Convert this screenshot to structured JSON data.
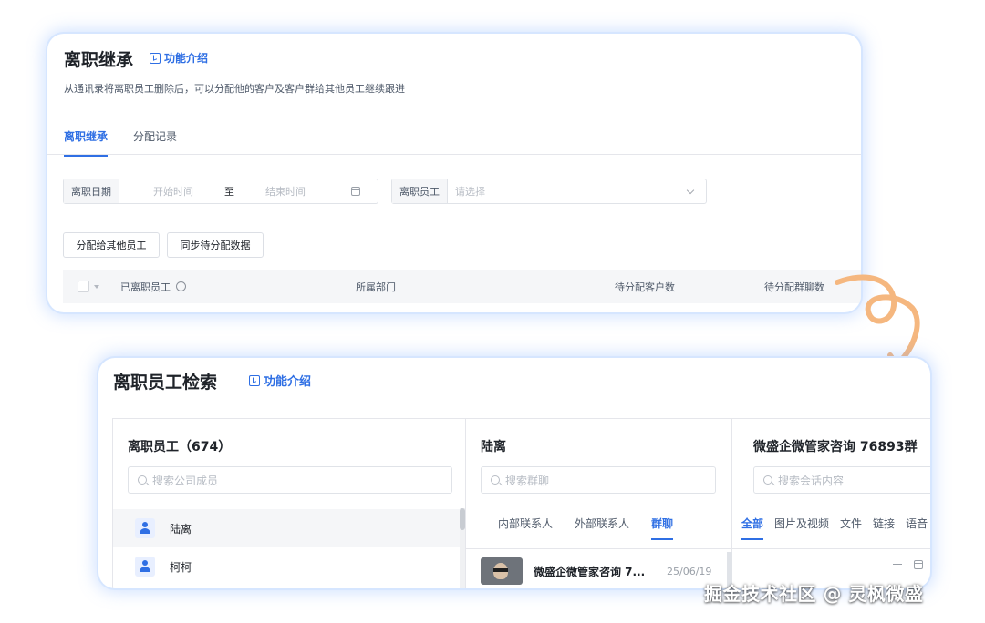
{
  "card1": {
    "title": "离职继承",
    "intro_link": "功能介绍",
    "description": "从通讯录将离职员工删除后，可以分配他的客户及客户群给其他员工继续跟进",
    "tabs": [
      {
        "label": "离职继承",
        "active": true
      },
      {
        "label": "分配记录",
        "active": false
      }
    ],
    "filters": {
      "date_label": "离职日期",
      "start_placeholder": "开始时间",
      "to": "至",
      "end_placeholder": "结束时间",
      "employee_label": "离职员工",
      "employee_placeholder": "请选择"
    },
    "buttons": {
      "assign": "分配给其他员工",
      "sync": "同步待分配数据"
    },
    "table_headers": [
      "已离职员工",
      "所属部门",
      "待分配客户数",
      "待分配群聊数"
    ]
  },
  "card2": {
    "title": "离职员工检索",
    "intro_link": "功能介绍",
    "employees_panel": {
      "heading": "离职员工（674）",
      "search_placeholder": "搜索公司成员",
      "employees": [
        {
          "name": "陆离",
          "selected": true
        },
        {
          "name": "柯柯",
          "selected": false
        }
      ]
    },
    "groups_panel": {
      "heading": "陆离",
      "search_placeholder": "搜索群聊",
      "tabs": [
        {
          "label": "内部联系人",
          "active": false
        },
        {
          "label": "外部联系人",
          "active": false
        },
        {
          "label": "群聊",
          "active": true
        }
      ],
      "groups": [
        {
          "name": "微盛企微管家咨询 7...",
          "date": "25/06/19"
        }
      ]
    },
    "chat_panel": {
      "heading": "微盛企微管家咨询 76893群",
      "search_placeholder": "搜索会话内容",
      "tabs": [
        {
          "label": "全部",
          "active": true
        },
        {
          "label": "图片及视频",
          "active": false
        },
        {
          "label": "文件",
          "active": false
        },
        {
          "label": "链接",
          "active": false
        },
        {
          "label": "语音",
          "active": false
        }
      ]
    }
  },
  "watermark": "掘金技术社区 @ 灵枫微盛",
  "colors": {
    "accent": "#2f6fe4",
    "arrow": "#f5b77f",
    "card_glow": "#d6e6ff"
  }
}
